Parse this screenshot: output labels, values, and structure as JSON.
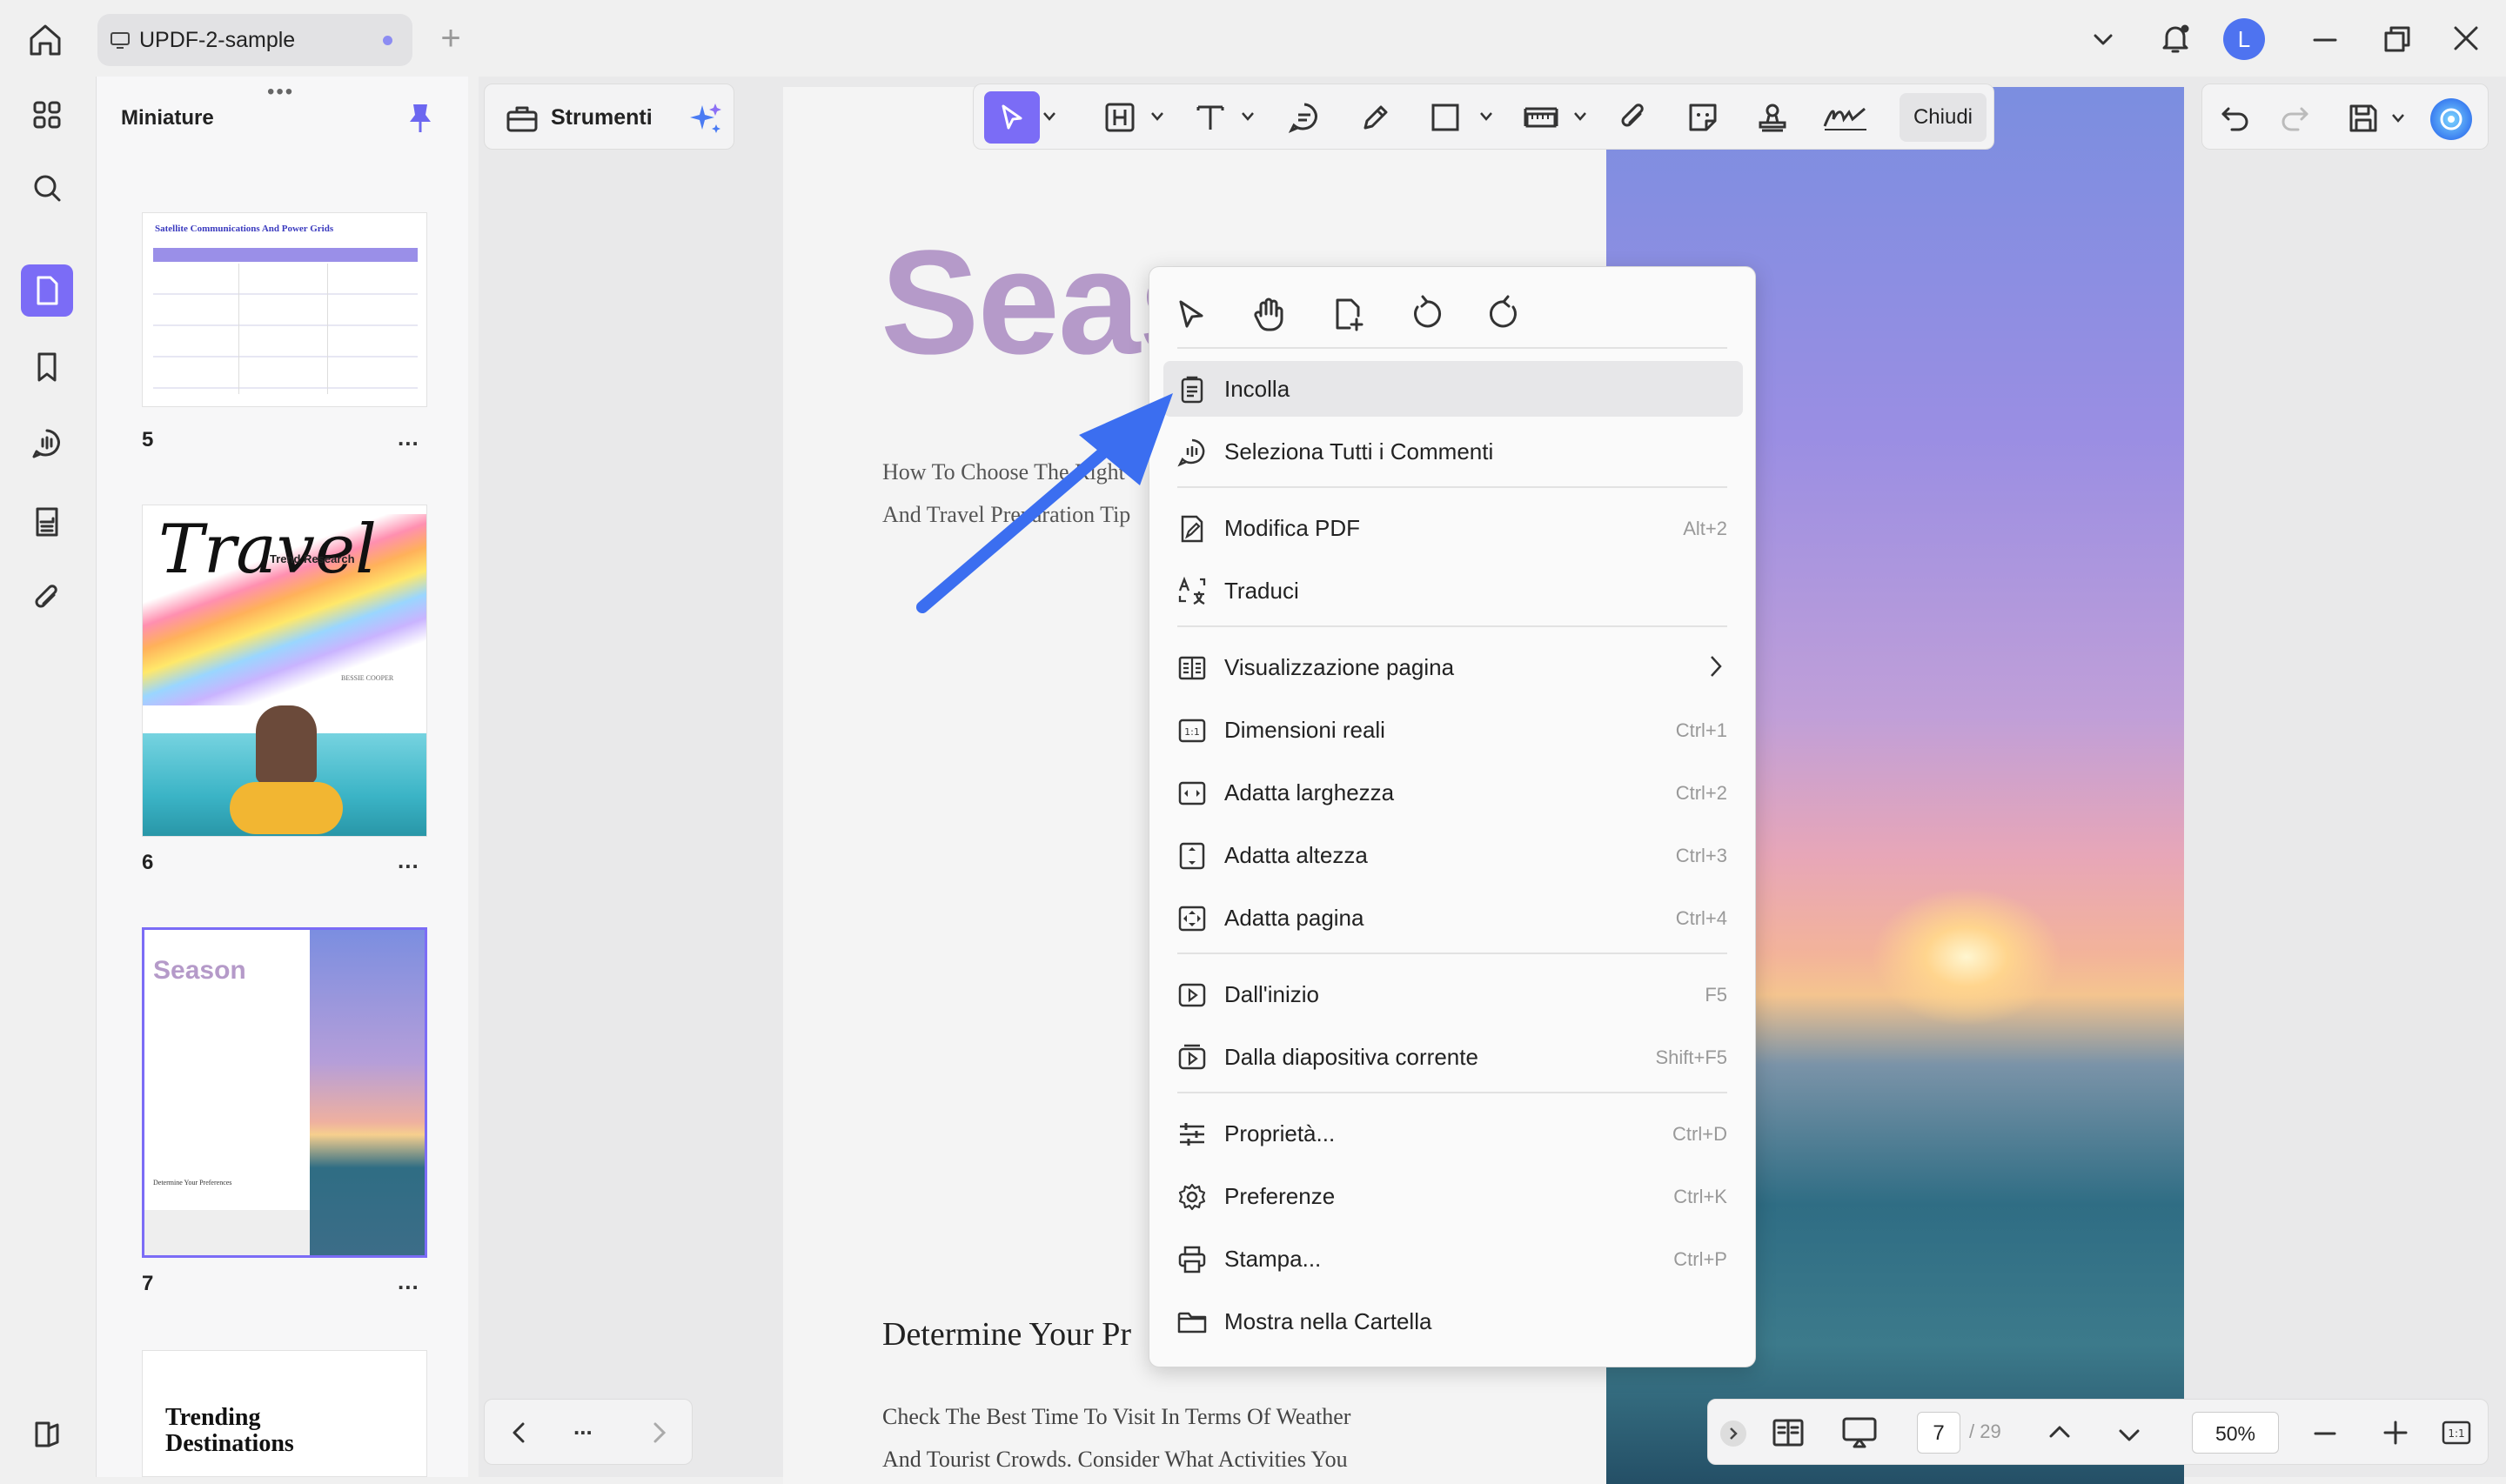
{
  "window": {
    "tab_title": "UPDF-2-sample",
    "new_tab": "+",
    "avatar_letter": "L"
  },
  "thumbnails": {
    "header": "Miniature",
    "pages": [
      {
        "number": "5",
        "title": "Satellite Communications And Power Grids",
        "more": "..."
      },
      {
        "number": "6",
        "title": "Travel",
        "subtitle": "Trend Research",
        "author": "BESSIE COOPER",
        "more": "..."
      },
      {
        "number": "7",
        "title": "Season",
        "section": "Determine Your Preferences",
        "more": "..."
      },
      {
        "number": "",
        "title": "Trending Destinations"
      }
    ]
  },
  "tools": {
    "label": "Strumenti"
  },
  "toolbar": {
    "close_label": "Chiudi"
  },
  "page_nav": {
    "more": "..."
  },
  "document": {
    "title": "Seas",
    "subtitle_line1": "How To Choose The Right",
    "subtitle_line2": "And Travel Preparation Tip",
    "section_heading": "Determine Your Pr",
    "body_line1": "Check The Best Time To Visit In Terms Of Weather",
    "body_line2": "And Tourist Crowds. Consider What Activities You"
  },
  "bottom_bar": {
    "current_page": "7",
    "total_pages": "/ 29",
    "zoom": "50%"
  },
  "context_menu": {
    "quick_icons": [
      "cursor-icon",
      "hand-icon",
      "add-page-icon",
      "rotate-left-icon",
      "rotate-right-icon"
    ],
    "items": [
      {
        "label": "Incolla",
        "shortcut": "",
        "icon": "clipboard-icon",
        "highlighted": true
      },
      {
        "label": "Seleziona Tutti i Commenti",
        "shortcut": "",
        "icon": "comment-icon"
      },
      {
        "label": "Modifica PDF",
        "shortcut": "Alt+2",
        "icon": "edit-pdf-icon"
      },
      {
        "label": "Traduci",
        "shortcut": "",
        "icon": "translate-icon"
      },
      {
        "label": "Visualizzazione pagina",
        "shortcut": "",
        "icon": "page-view-icon",
        "submenu": true
      },
      {
        "label": "Dimensioni reali",
        "shortcut": "Ctrl+1",
        "icon": "actual-size-icon"
      },
      {
        "label": "Adatta larghezza",
        "shortcut": "Ctrl+2",
        "icon": "fit-width-icon"
      },
      {
        "label": "Adatta altezza",
        "shortcut": "Ctrl+3",
        "icon": "fit-height-icon"
      },
      {
        "label": "Adatta pagina",
        "shortcut": "Ctrl+4",
        "icon": "fit-page-icon"
      },
      {
        "label": "Dall'inizio",
        "shortcut": "F5",
        "icon": "play-start-icon"
      },
      {
        "label": "Dalla diapositiva corrente",
        "shortcut": "Shift+F5",
        "icon": "play-current-icon"
      },
      {
        "label": "Proprietà...",
        "shortcut": "Ctrl+D",
        "icon": "properties-icon"
      },
      {
        "label": "Preferenze",
        "shortcut": "Ctrl+K",
        "icon": "gear-icon"
      },
      {
        "label": "Stampa...",
        "shortcut": "Ctrl+P",
        "icon": "printer-icon"
      },
      {
        "label": "Mostra nella Cartella",
        "shortcut": "",
        "icon": "folder-icon"
      }
    ]
  },
  "colors": {
    "accent": "#7b6cf6",
    "arrow": "#3b6ef0",
    "title_purple": "#b59ac9"
  }
}
